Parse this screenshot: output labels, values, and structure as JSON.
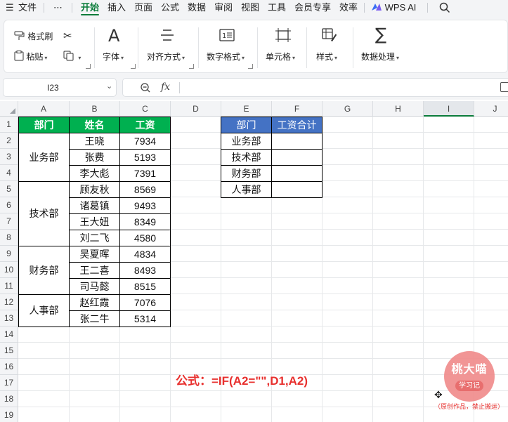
{
  "menubar": {
    "hamburger": "☰",
    "file": "文件",
    "more": "⋯",
    "tabs": [
      "开始",
      "插入",
      "页面",
      "公式",
      "数据",
      "审阅",
      "视图",
      "工具",
      "会员专享",
      "效率"
    ],
    "active_tab": "开始",
    "wps_ai": "WPS AI",
    "search_icon": "search-icon"
  },
  "ribbon": {
    "format_painter": "格式刷",
    "paste": "粘贴",
    "font": "字体",
    "align": "对齐方式",
    "number_format": "数字格式",
    "cell": "单元格",
    "style": "样式",
    "data_processing": "数据处理"
  },
  "formula_bar": {
    "name_box": "I23",
    "fx": "fx",
    "value": ""
  },
  "grid": {
    "columns": [
      "A",
      "B",
      "C",
      "D",
      "E",
      "F",
      "G",
      "H",
      "I",
      "J"
    ],
    "selected_column": "I",
    "rows": [
      "1",
      "2",
      "3",
      "4",
      "5",
      "6",
      "7",
      "8",
      "9",
      "10",
      "11",
      "12",
      "13",
      "14",
      "15",
      "16",
      "17",
      "18",
      "19"
    ]
  },
  "table1": {
    "headers": [
      "部门",
      "姓名",
      "工资"
    ],
    "departments": [
      "业务部",
      "技术部",
      "财务部",
      "人事部"
    ],
    "names": [
      "王晓",
      "张费",
      "李大彪",
      "顾友秋",
      "诸葛镇",
      "王大妞",
      "刘二飞",
      "吴夏晖",
      "王二喜",
      "司马懿",
      "赵红霞",
      "张二牛"
    ],
    "salaries": [
      "7934",
      "5193",
      "7391",
      "8569",
      "9493",
      "8349",
      "4580",
      "4834",
      "8493",
      "8515",
      "7076",
      "5314"
    ]
  },
  "table2": {
    "headers": [
      "部门",
      "工资合计"
    ],
    "departments": [
      "业务部",
      "技术部",
      "财务部",
      "人事部"
    ]
  },
  "annotation": {
    "formula": "公式：=IF(A2=\"\",D1,A2)",
    "stamp_line1": "桃大喵",
    "stamp_line2": "学习记",
    "stamp_note": "（原创作品，禁止搬运）"
  },
  "colors": {
    "header_green": "#00b050",
    "header_blue": "#4472c4",
    "accent_green": "#0a7c3a",
    "formula_red": "#e8302e"
  }
}
